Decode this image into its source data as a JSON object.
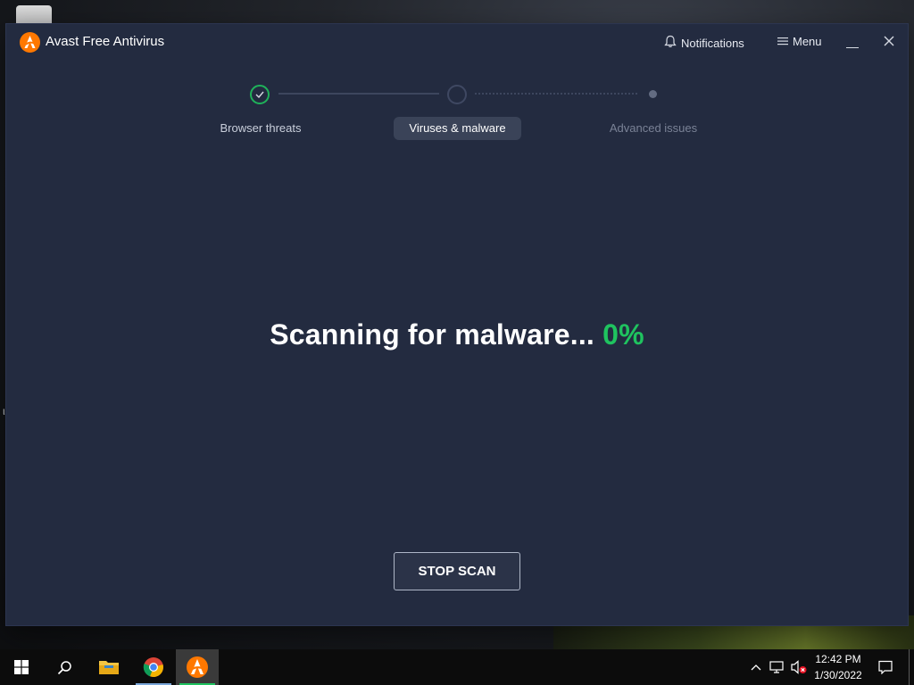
{
  "window": {
    "title": "Avast Free Antivirus",
    "notifications_label": "Notifications",
    "menu_label": "Menu"
  },
  "stepper": {
    "steps": [
      {
        "label": "Browser threats",
        "state": "done"
      },
      {
        "label": "Viruses & malware",
        "state": "active"
      },
      {
        "label": "Advanced issues",
        "state": "pending"
      }
    ]
  },
  "scan": {
    "text": "Scanning for malware...",
    "percent": "0%",
    "stop_label": "STOP SCAN"
  },
  "taskbar": {
    "apps": [
      "start-icon",
      "search-icon",
      "file-explorer-icon",
      "chrome-icon",
      "avast-icon"
    ],
    "clock_time": "12:42 PM",
    "clock_date": "1/30/2022"
  },
  "colors": {
    "window_bg": "#232b40",
    "accent_green": "#1fc35f",
    "brand_orange": "#ff7800"
  }
}
